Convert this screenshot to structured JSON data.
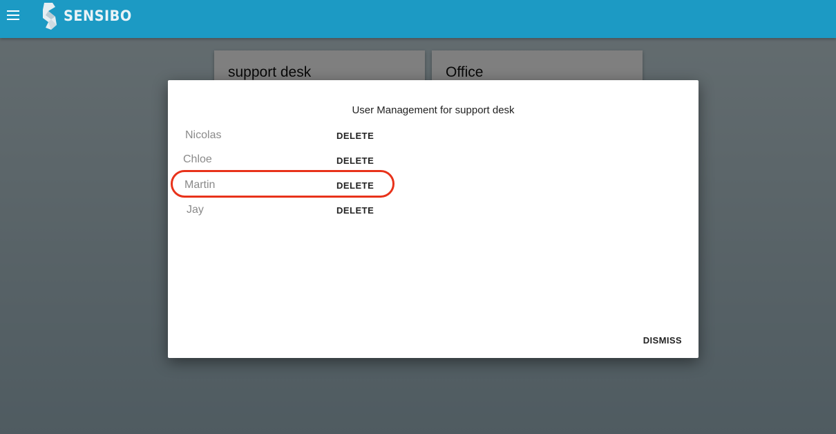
{
  "header": {
    "brand": "SENSIBO",
    "colors": {
      "bar": "#1c9ac4",
      "logo": "#eaf3f7"
    }
  },
  "cards": [
    {
      "title": "support desk"
    },
    {
      "title": "Office"
    }
  ],
  "dialog": {
    "title": "User Management for support desk",
    "users": [
      {
        "name": "Nicolas",
        "action": "DELETE"
      },
      {
        "name": "Chloe",
        "action": "DELETE"
      },
      {
        "name": "Martin",
        "action": "DELETE"
      },
      {
        "name": "Jay",
        "action": "DELETE"
      }
    ],
    "dismiss_label": "DISMISS",
    "highlight_color": "#e8321a"
  },
  "icons": {
    "menu": "hamburger-menu-icon",
    "logo": "sensibo-logo-icon"
  }
}
